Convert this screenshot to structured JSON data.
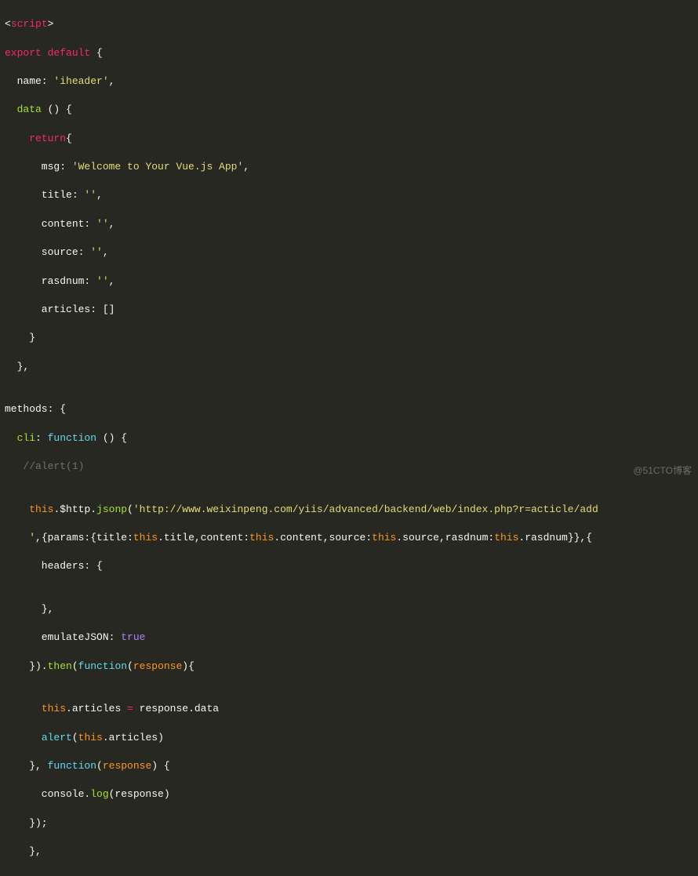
{
  "code": {
    "l01_a": "<",
    "l01_b": "script",
    "l01_c": ">",
    "l02_a": "export",
    "l02_b": " ",
    "l02_c": "default",
    "l02_d": " {",
    "l03_a": "  name: ",
    "l03_b": "'iheader'",
    "l03_c": ",",
    "l04_a": "  ",
    "l04_b": "data",
    "l04_c": " () {",
    "l05_a": "    ",
    "l05_b": "return",
    "l05_c": "{",
    "l06_a": "      msg: ",
    "l06_b": "'Welcome to Your Vue.js App'",
    "l06_c": ",",
    "l07_a": "      title: ",
    "l07_b": "''",
    "l07_c": ",",
    "l08_a": "      content: ",
    "l08_b": "''",
    "l08_c": ",",
    "l09_a": "      source: ",
    "l09_b": "''",
    "l09_c": ",",
    "l10_a": "      rasdnum: ",
    "l10_b": "''",
    "l10_c": ",",
    "l11_a": "      articles: []",
    "l12_a": "    }",
    "l13_a": "  },",
    "l14_a": "",
    "l15_a": "methods: {",
    "l16_a": "  ",
    "l16_b": "cli",
    "l16_c": ": ",
    "l16_d": "function",
    "l16_e": " () {",
    "l17_a": "   ",
    "l17_b": "//alert(1)",
    "l18_a": "",
    "l19_a": "    ",
    "l19_b": "this",
    "l19_c": ".$http.",
    "l19_d": "jsonp",
    "l19_e": "(",
    "l19_f": "'http://www.weixinpeng.com/yiis/advanced/backend/web/index.php?r=acticle/add",
    "l20_a": "    '",
    "l20_b": ",{params:{title:",
    "l20_c": "this",
    "l20_d": ".title,content:",
    "l20_e": "this",
    "l20_f": ".content,source:",
    "l20_g": "this",
    "l20_h": ".source,rasdnum:",
    "l20_i": "this",
    "l20_j": ".rasdnum}},{",
    "l21_a": "      headers: {",
    "l22_a": "",
    "l23_a": "      },",
    "l24_a": "      emulateJSON: ",
    "l24_b": "true",
    "l25_a": "    }).",
    "l25_b": "then",
    "l25_c": "(",
    "l25_d": "function",
    "l25_e": "(",
    "l25_f": "response",
    "l25_g": "){",
    "l26_a": "",
    "l27_a": "      ",
    "l27_b": "this",
    "l27_c": ".articles ",
    "l27_d": "=",
    "l27_e": " response.data",
    "l28_a": "      ",
    "l28_b": "alert",
    "l28_c": "(",
    "l28_d": "this",
    "l28_e": ".articles)",
    "l29_a": "    }, ",
    "l29_b": "function",
    "l29_c": "(",
    "l29_d": "response",
    "l29_e": ") {",
    "l30_a": "      console.",
    "l30_b": "log",
    "l30_c": "(response)",
    "l31_a": "    });",
    "l32_a": "    },"
  },
  "watermark": "@51CTO博客"
}
